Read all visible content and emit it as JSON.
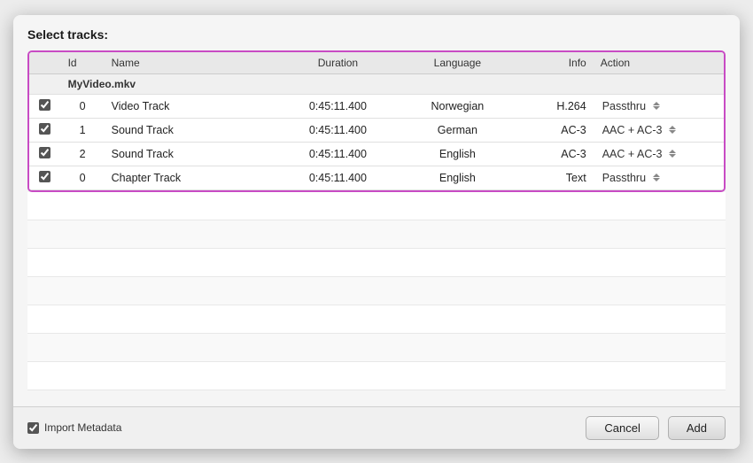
{
  "dialog": {
    "title": "Select tracks:",
    "columns": {
      "id": "Id",
      "name": "Name",
      "duration": "Duration",
      "language": "Language",
      "info": "Info",
      "action": "Action"
    },
    "group": {
      "label": "MyVideo.mkv"
    },
    "tracks": [
      {
        "checked": true,
        "id": "0",
        "name": "Video Track",
        "duration": "0:45:11.400",
        "language": "Norwegian",
        "info": "H.264",
        "action": "Passthru"
      },
      {
        "checked": true,
        "id": "1",
        "name": "Sound Track",
        "duration": "0:45:11.400",
        "language": "German",
        "info": "AC-3",
        "action": "AAC + AC-3"
      },
      {
        "checked": true,
        "id": "2",
        "name": "Sound Track",
        "duration": "0:45:11.400",
        "language": "English",
        "info": "AC-3",
        "action": "AAC + AC-3"
      },
      {
        "checked": true,
        "id": "0",
        "name": "Chapter Track",
        "duration": "0:45:11.400",
        "language": "English",
        "info": "Text",
        "action": "Passthru"
      }
    ],
    "footer": {
      "import_meta_label": "Import Metadata",
      "import_meta_checked": true,
      "cancel_label": "Cancel",
      "add_label": "Add"
    }
  }
}
